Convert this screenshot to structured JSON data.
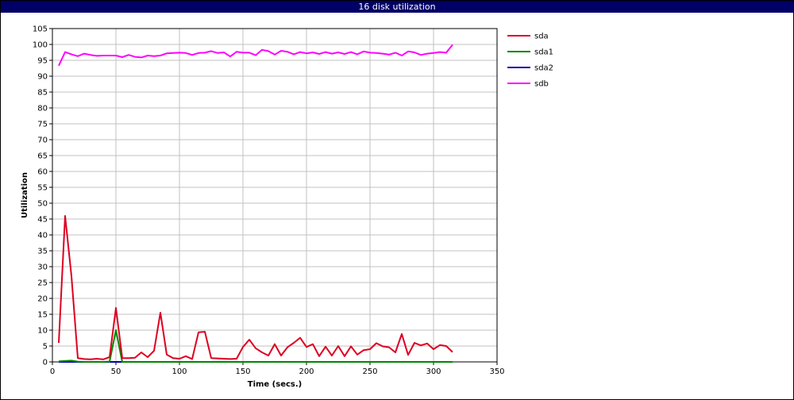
{
  "window": {
    "title": "16 disk utilization"
  },
  "chart_data": {
    "type": "line",
    "title": "16 disk utilization",
    "xlabel": "Time (secs.)",
    "ylabel": "Utilization",
    "xlim": [
      0,
      350
    ],
    "ylim": [
      0,
      105
    ],
    "xticks": [
      0,
      50,
      100,
      150,
      200,
      250,
      300,
      350
    ],
    "yticks": [
      0,
      5,
      10,
      15,
      20,
      25,
      30,
      35,
      40,
      45,
      50,
      55,
      60,
      65,
      70,
      75,
      80,
      85,
      90,
      95,
      100,
      105
    ],
    "grid": true,
    "legend_position": "right",
    "series": [
      {
        "name": "sda",
        "color": "#dd0022",
        "x": [
          5,
          10,
          15,
          20,
          25,
          30,
          35,
          40,
          45,
          50,
          55,
          60,
          65,
          70,
          75,
          80,
          85,
          90,
          95,
          100,
          105,
          110,
          115,
          120,
          125,
          130,
          135,
          140,
          145,
          150,
          155,
          160,
          165,
          170,
          175,
          180,
          185,
          190,
          195,
          200,
          205,
          210,
          215,
          220,
          225,
          230,
          235,
          240,
          245,
          250,
          255,
          260,
          265,
          270,
          275,
          280,
          285,
          290,
          295,
          300,
          305,
          310,
          315
        ],
        "y": [
          6,
          46,
          27,
          1.2,
          0.9,
          0.8,
          1,
          0.8,
          1.5,
          17,
          1.2,
          1.2,
          1.3,
          3,
          1.5,
          3.5,
          15.5,
          2.3,
          1.2,
          1,
          1.8,
          0.9,
          9.3,
          9.5,
          1.2,
          1.1,
          1,
          0.9,
          1,
          4.7,
          7,
          4.3,
          3,
          2,
          5.6,
          2,
          4.6,
          6,
          7.6,
          4.7,
          5.6,
          1.8,
          4.8,
          2,
          5,
          1.8,
          4.9,
          2.3,
          3.7,
          4,
          5.9,
          4.9,
          4.6,
          3,
          8.8,
          2.2,
          6,
          5.2,
          5.8,
          4,
          5.3,
          5,
          3.1
        ]
      },
      {
        "name": "sda1",
        "color": "#008800",
        "x": [
          5,
          10,
          15,
          20,
          25,
          30,
          35,
          40,
          45,
          50,
          55,
          60,
          65,
          70,
          75,
          80,
          85,
          90,
          95,
          100,
          105,
          110,
          115,
          120,
          125,
          130,
          135,
          140,
          145,
          150,
          155,
          160,
          165,
          170,
          175,
          180,
          185,
          190,
          195,
          200,
          205,
          210,
          215,
          220,
          225,
          230,
          235,
          240,
          245,
          250,
          255,
          260,
          265,
          270,
          275,
          280,
          285,
          290,
          295,
          300,
          305,
          310,
          315
        ],
        "y": [
          0.2,
          0.3,
          0.4,
          0.1,
          0,
          0,
          0,
          0,
          0.1,
          10,
          0,
          0,
          0,
          0,
          0,
          0,
          0,
          0,
          0,
          0,
          0,
          0,
          0,
          0,
          0,
          0,
          0,
          0,
          0,
          0,
          0,
          0,
          0,
          0,
          0,
          0,
          0,
          0,
          0,
          0,
          0,
          0,
          0,
          0,
          0,
          0,
          0,
          0,
          0,
          0,
          0,
          0,
          0,
          0,
          0,
          0,
          0,
          0,
          0,
          0,
          0,
          0,
          0
        ]
      },
      {
        "name": "sda2",
        "color": "#0000aa",
        "x": [
          5,
          315
        ],
        "y": [
          0,
          0
        ]
      },
      {
        "name": "sdb",
        "color": "#ff00ff",
        "x": [
          5,
          10,
          15,
          20,
          25,
          30,
          35,
          40,
          45,
          50,
          55,
          60,
          65,
          70,
          75,
          80,
          85,
          90,
          95,
          100,
          105,
          110,
          115,
          120,
          125,
          130,
          135,
          140,
          145,
          150,
          155,
          160,
          165,
          170,
          175,
          180,
          185,
          190,
          195,
          200,
          205,
          210,
          215,
          220,
          225,
          230,
          235,
          240,
          245,
          250,
          255,
          260,
          265,
          270,
          275,
          280,
          285,
          290,
          295,
          300,
          305,
          310,
          315
        ],
        "y": [
          93.3,
          97.6,
          96.9,
          96.3,
          97.1,
          96.7,
          96.4,
          96.5,
          96.5,
          96.5,
          96.0,
          96.7,
          96.1,
          95.9,
          96.5,
          96.3,
          96.5,
          97.2,
          97.3,
          97.4,
          97.3,
          96.7,
          97.3,
          97.4,
          97.9,
          97.3,
          97.5,
          96.2,
          97.7,
          97.4,
          97.4,
          96.6,
          98.3,
          97.9,
          96.8,
          98.0,
          97.7,
          96.9,
          97.6,
          97.2,
          97.5,
          97.0,
          97.6,
          97.1,
          97.5,
          97.0,
          97.6,
          96.9,
          97.8,
          97.4,
          97.3,
          97.1,
          96.8,
          97.4,
          96.5,
          97.8,
          97.5,
          96.7,
          97.1,
          97.3,
          97.6,
          97.4,
          99.9
        ]
      }
    ]
  }
}
